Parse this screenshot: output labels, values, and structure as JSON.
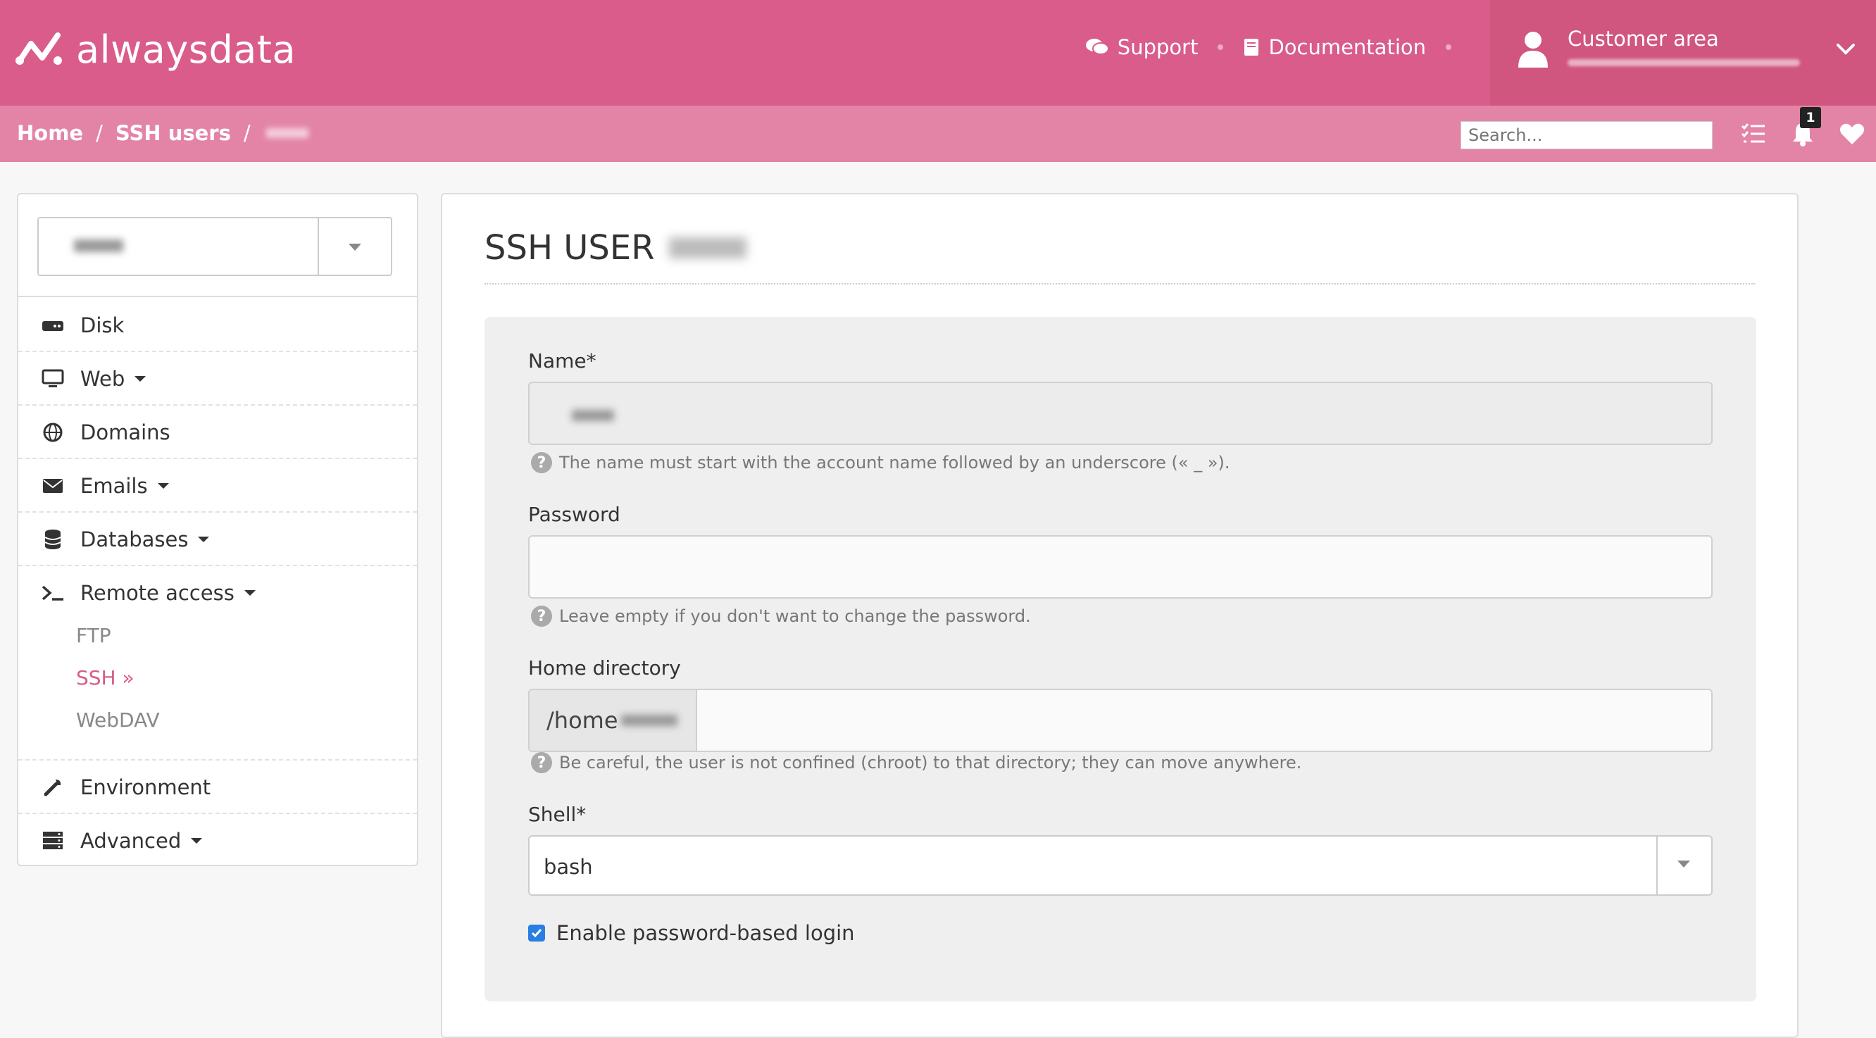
{
  "brand": {
    "name": "alwaysdata"
  },
  "topnav": {
    "support": "Support",
    "documentation": "Documentation",
    "customer_area": "Customer area"
  },
  "breadcrumb": {
    "home": "Home",
    "ssh_users": "SSH users"
  },
  "search": {
    "placeholder": "Search..."
  },
  "notifications": {
    "count": "1"
  },
  "sidebar": {
    "items": [
      {
        "label": "Disk",
        "icon": "disk-icon"
      },
      {
        "label": "Web",
        "icon": "monitor-icon"
      },
      {
        "label": "Domains",
        "icon": "globe-icon"
      },
      {
        "label": "Emails",
        "icon": "envelope-icon"
      },
      {
        "label": "Databases",
        "icon": "database-icon"
      },
      {
        "label": "Remote access",
        "icon": "terminal-icon"
      },
      {
        "label": "Environment",
        "icon": "wrench-icon"
      },
      {
        "label": "Advanced",
        "icon": "server-icon"
      }
    ],
    "remote_sub": [
      {
        "label": "FTP"
      },
      {
        "label": "SSH »"
      },
      {
        "label": "WebDAV"
      }
    ]
  },
  "page": {
    "title": "SSH USER"
  },
  "form": {
    "name_label": "Name*",
    "name_help": "The name must start with the account name followed by an underscore (« _ »).",
    "password_label": "Password",
    "password_help": "Leave empty if you don't want to change the password.",
    "home_label": "Home directory",
    "home_prefix": "/home",
    "home_help": "Be careful, the user is not confined (chroot) to that directory; they can move anywhere.",
    "shell_label": "Shell*",
    "shell_value": "bash",
    "password_login_label": "Enable password-based login",
    "password_login_checked": true
  },
  "colors": {
    "brand": "#d95c8a",
    "brand_light": "#e384a7",
    "accent_active": "#d95c8a",
    "checkbox": "#2a7de1"
  }
}
